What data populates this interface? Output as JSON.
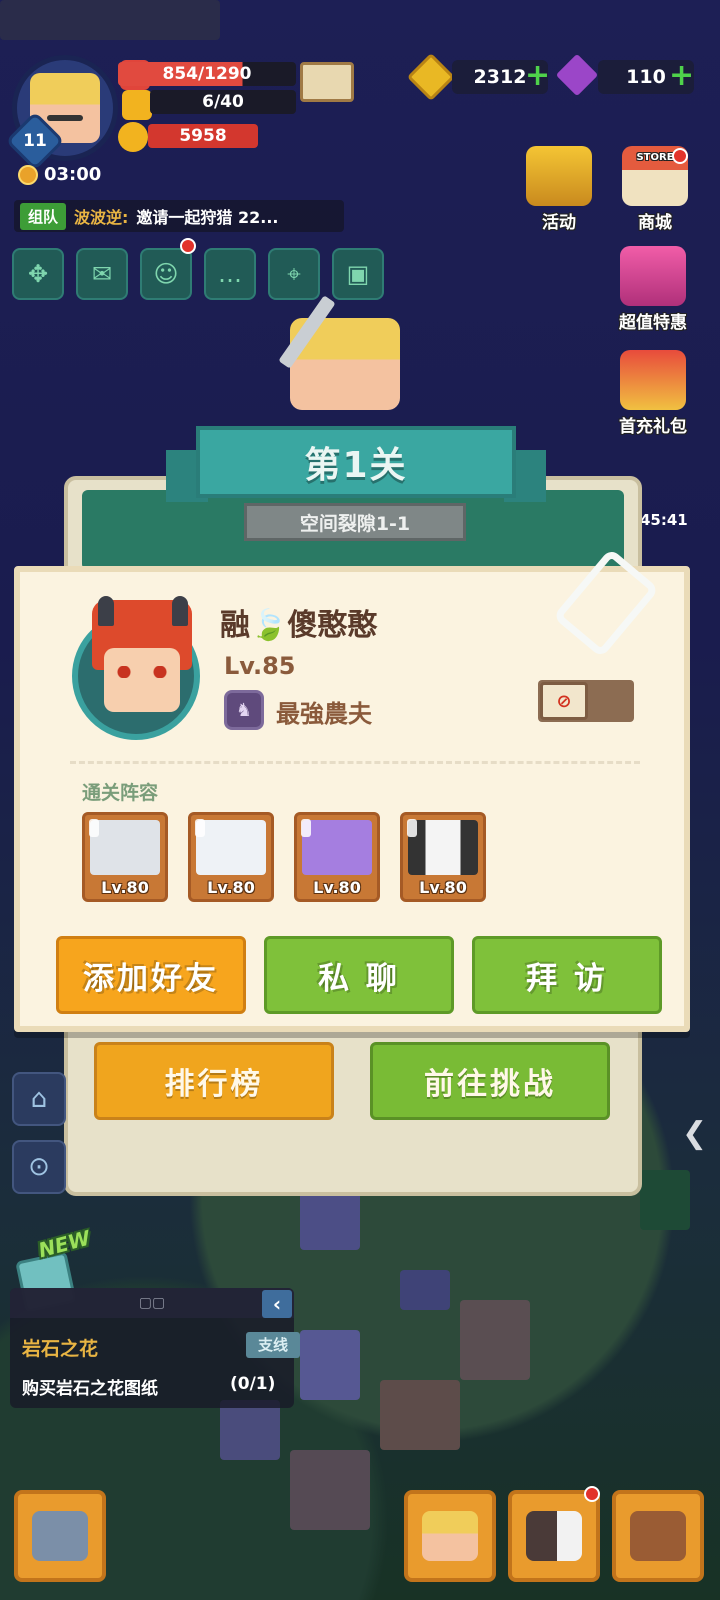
{
  "hud": {
    "player_level": "11",
    "hp": "854/1290",
    "stamina": "6/40",
    "power": "5958",
    "timer": "03:00",
    "gold": "2312",
    "gems": "110"
  },
  "team_chat": {
    "tag": "组队",
    "sender": "波波逆:",
    "message": "邀请一起狩猎 22..."
  },
  "side_menu": [
    {
      "label": "活动",
      "icon": "activity-icon"
    },
    {
      "label": "商城",
      "icon": "store-icon"
    },
    {
      "label": "超值特惠",
      "icon": "gift-box-icon"
    },
    {
      "label": "首充礼包",
      "icon": "first-recharge-icon"
    }
  ],
  "store_sign": "STORE",
  "countdown": "45:41",
  "stage": {
    "title": "第1关",
    "subtitle": "空间裂隙1-1",
    "rank_button": "排行榜",
    "challenge_button": "前往挑战"
  },
  "player_card": {
    "name": "融🍃傻憨憨",
    "level": "Lv.85",
    "title": "最強農夫",
    "lineup_label": "通关阵容",
    "pets": [
      {
        "level": "Lv.80",
        "name": "white-wolf-pet",
        "color": "#e9ecef"
      },
      {
        "level": "Lv.80",
        "name": "snow-seal-pet",
        "color": "#eef2f6"
      },
      {
        "level": "Lv.80",
        "name": "purple-elephant-pet",
        "color": "#a57ee0"
      },
      {
        "level": "Lv.80",
        "name": "panda-pet",
        "color": "#f4f4f4"
      }
    ],
    "add_friend_button": "添加好友",
    "private_chat_button": "私 聊",
    "visit_button": "拜 访"
  },
  "quest": {
    "new_badge": "NEW",
    "header": "▢▢",
    "collapse": "‹",
    "name": "岩石之花",
    "tag": "支线",
    "description": "购买岩石之花图纸",
    "progress": "(0/1)"
  },
  "colors": {
    "orange_button": "#f5a41e",
    "green_button": "#7fc13a",
    "panel_bg": "#fbf3e0"
  }
}
